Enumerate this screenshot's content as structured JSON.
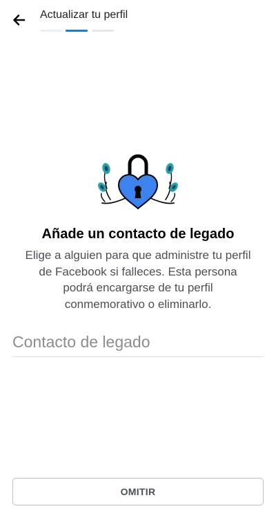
{
  "header": {
    "title": "Actualizar tu perfil",
    "progress": {
      "current_step": 2,
      "total_steps": 3
    }
  },
  "icons": {
    "back": "arrow-left-icon",
    "illustration": "heart-padlock-illustration"
  },
  "colors": {
    "accent": "#1877f2",
    "lock": "#3d83f0",
    "leaf": "#26a69a"
  },
  "main": {
    "title": "Añade un contacto de legado",
    "description": "Elige a alguien para que administre tu perfil de Facebook si falleces. Esta persona podrá encargarse de tu perfil conmemorativo o eliminarlo.",
    "input": {
      "placeholder": "Contacto de legado",
      "value": ""
    }
  },
  "footer": {
    "skip_label": "OMITIR"
  }
}
